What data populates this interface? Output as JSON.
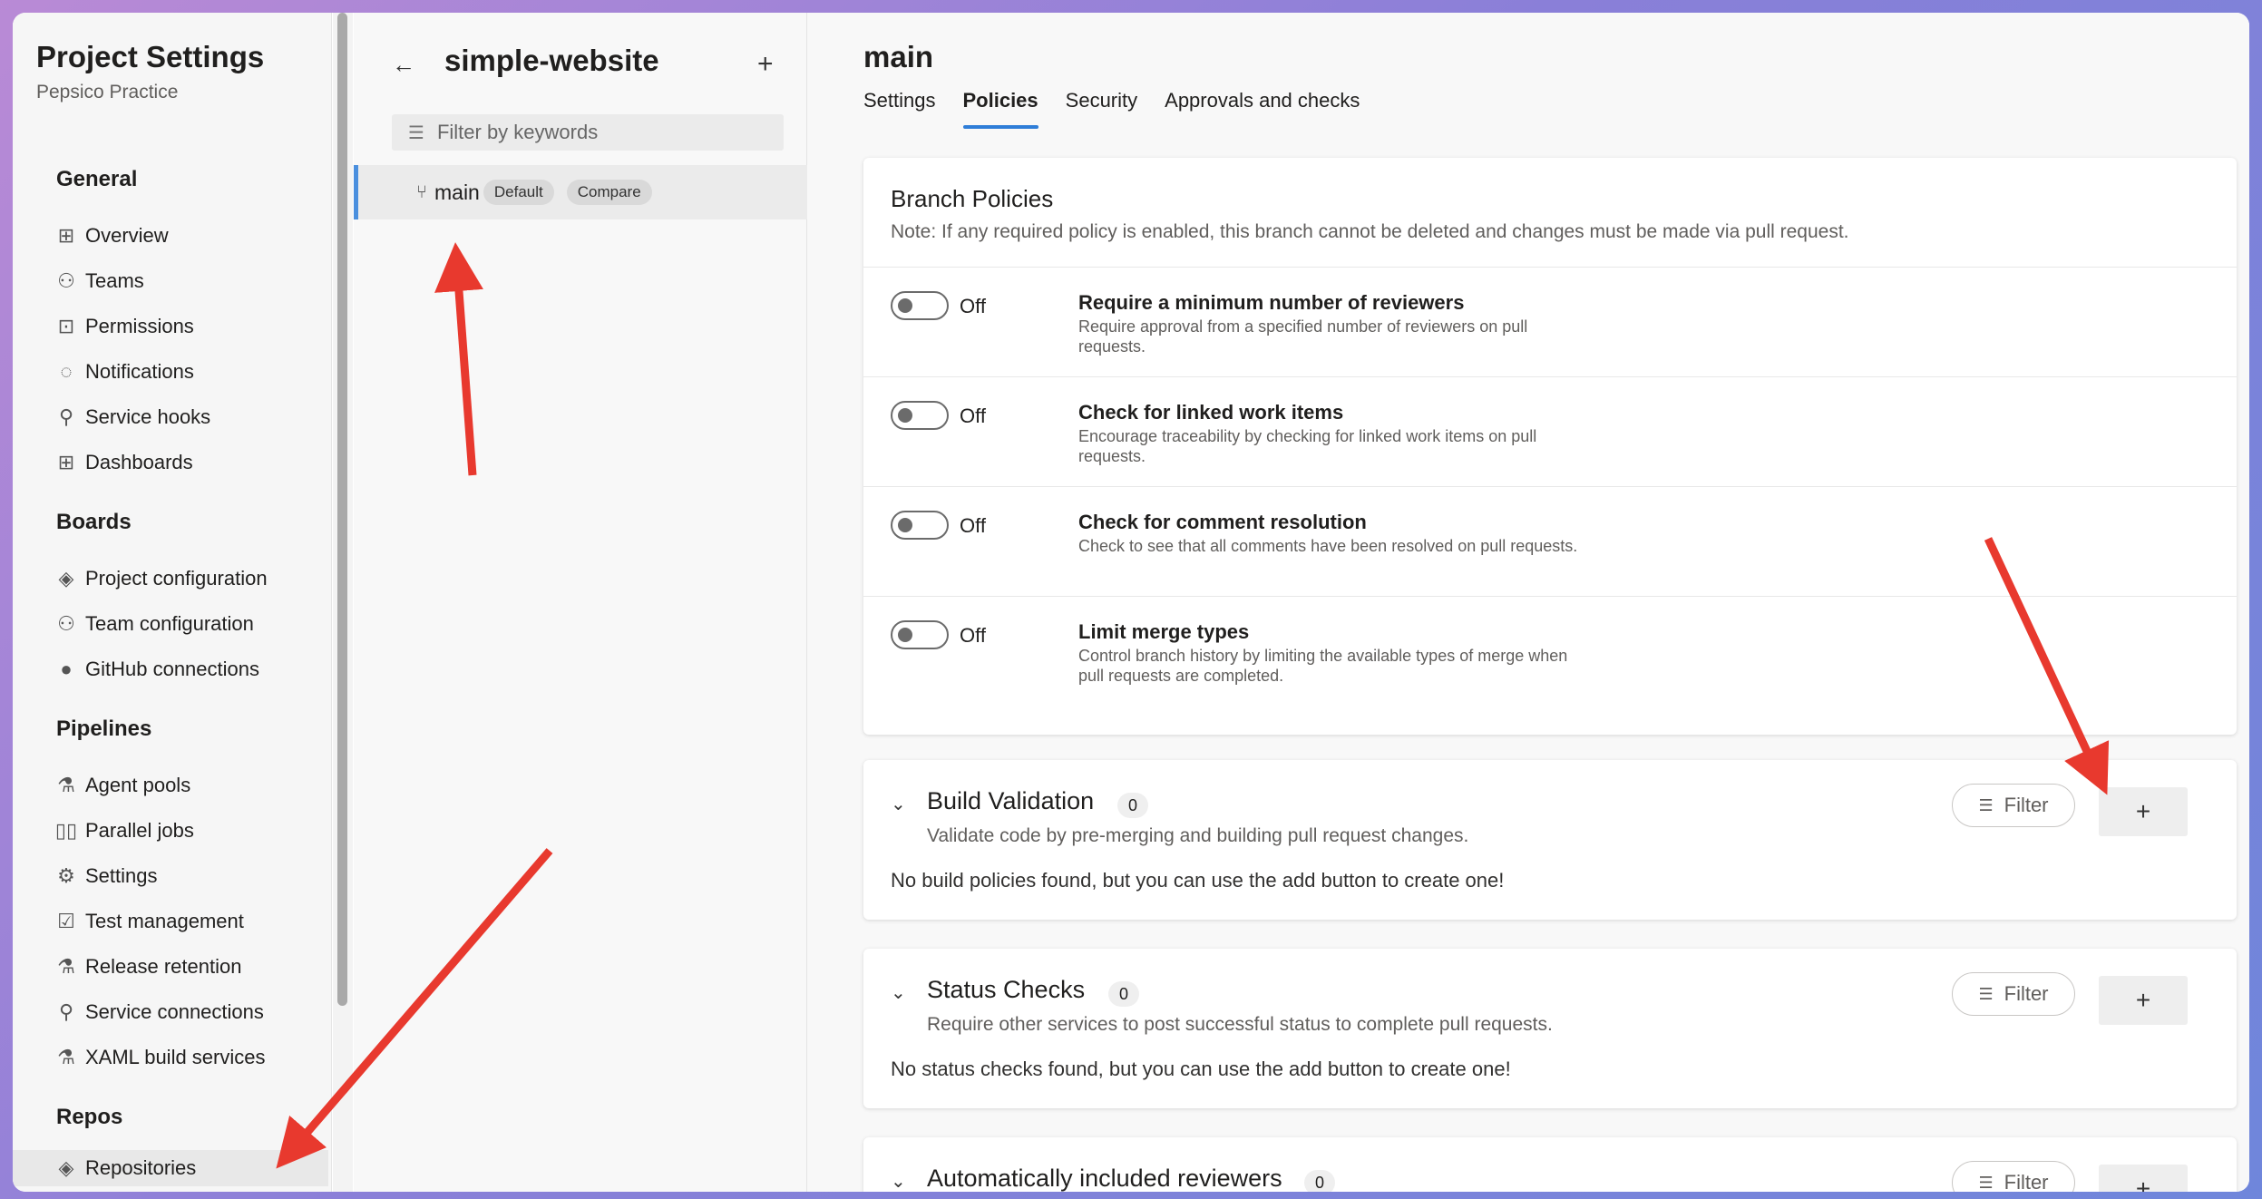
{
  "nav": {
    "title": "Project Settings",
    "subtitle": "Pepsico Practice",
    "sections": [
      {
        "label": "General",
        "items": [
          {
            "label": "Overview",
            "icon": "overview-icon"
          },
          {
            "label": "Teams",
            "icon": "teams-icon"
          },
          {
            "label": "Permissions",
            "icon": "lock-icon"
          },
          {
            "label": "Notifications",
            "icon": "notification-icon"
          },
          {
            "label": "Service hooks",
            "icon": "service-hooks-icon"
          },
          {
            "label": "Dashboards",
            "icon": "dashboard-icon"
          }
        ]
      },
      {
        "label": "Boards",
        "items": [
          {
            "label": "Project configuration",
            "icon": "project-config-icon"
          },
          {
            "label": "Team configuration",
            "icon": "team-config-icon"
          },
          {
            "label": "GitHub connections",
            "icon": "github-icon"
          }
        ]
      },
      {
        "label": "Pipelines",
        "items": [
          {
            "label": "Agent pools",
            "icon": "agent-pool-icon"
          },
          {
            "label": "Parallel jobs",
            "icon": "parallel-jobs-icon"
          },
          {
            "label": "Settings",
            "icon": "gear-icon"
          },
          {
            "label": "Test management",
            "icon": "test-management-icon"
          },
          {
            "label": "Release retention",
            "icon": "release-retention-icon"
          },
          {
            "label": "Service connections",
            "icon": "service-connections-icon"
          },
          {
            "label": "XAML build services",
            "icon": "xaml-icon"
          }
        ]
      },
      {
        "label": "Repos",
        "items": [
          {
            "label": "Repositories",
            "icon": "repo-icon"
          }
        ]
      }
    ]
  },
  "repo": {
    "title": "simple-website",
    "filter_placeholder": "Filter by keywords",
    "branch": {
      "name": "main",
      "default_label": "Default",
      "compare_label": "Compare"
    }
  },
  "main": {
    "title": "main",
    "tabs": [
      "Settings",
      "Policies",
      "Security",
      "Approvals and checks"
    ],
    "active_tab": "Policies",
    "branch_policies": {
      "title": "Branch Policies",
      "note": "Note: If any required policy is enabled, this branch cannot be deleted and changes must be made via pull request.",
      "items": [
        {
          "state": "Off",
          "title": "Require a minimum number of reviewers",
          "desc": "Require approval from a specified number of reviewers on pull requests."
        },
        {
          "state": "Off",
          "title": "Check for linked work items",
          "desc": "Encourage traceability by checking for linked work items on pull requests."
        },
        {
          "state": "Off",
          "title": "Check for comment resolution",
          "desc": "Check to see that all comments have been resolved on pull requests."
        },
        {
          "state": "Off",
          "title": "Limit merge types",
          "desc": "Control branch history by limiting the available types of merge when pull requests are completed."
        }
      ]
    },
    "build_validation": {
      "title": "Build Validation",
      "count": "0",
      "desc": "Validate code by pre-merging and building pull request changes.",
      "empty": "No build policies found, but you can use the add button to create one!",
      "filter": "Filter"
    },
    "status_checks": {
      "title": "Status Checks",
      "count": "0",
      "desc": "Require other services to post successful status to complete pull requests.",
      "empty": "No status checks found, but you can use the add button to create one!",
      "filter": "Filter"
    },
    "auto_reviewers": {
      "title": "Automatically included reviewers",
      "count": "0",
      "filter": "Filter"
    }
  },
  "colors": {
    "accent": "#2f7ed8",
    "annotation_arrow": "#e8392e"
  }
}
